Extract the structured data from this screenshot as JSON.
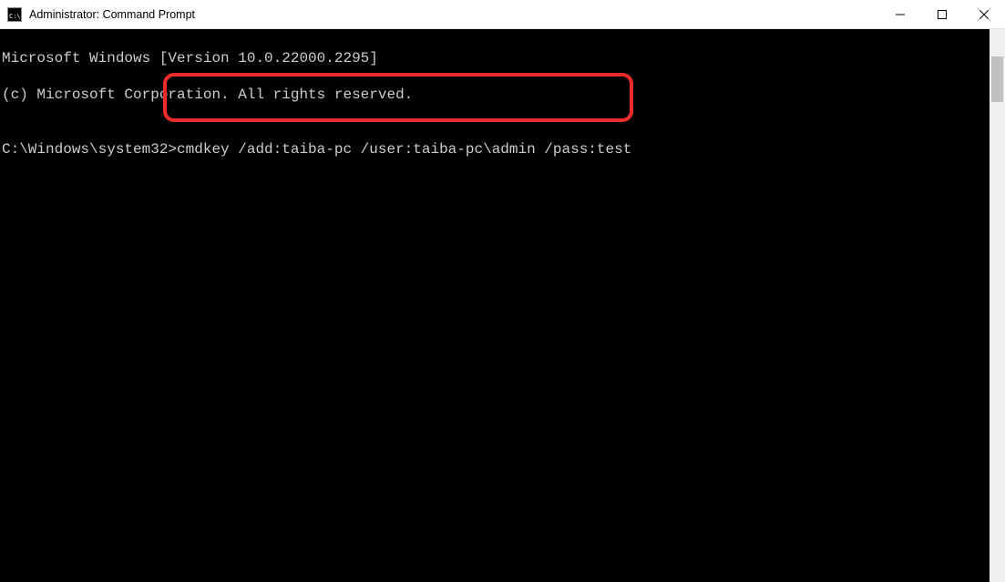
{
  "titlebar": {
    "title": "Administrator: Command Prompt"
  },
  "terminal": {
    "line1": "Microsoft Windows [Version 10.0.22000.2295]",
    "line2": "(c) Microsoft Corporation. All rights reserved.",
    "blank": "",
    "prompt": "C:\\Windows\\system32>",
    "command": "cmdkey /add:taiba-pc /user:taiba-pc\\admin /pass:test"
  },
  "colors": {
    "terminal_bg": "#000000",
    "terminal_fg": "#cccccc",
    "highlight_border": "#ee2b2b"
  }
}
